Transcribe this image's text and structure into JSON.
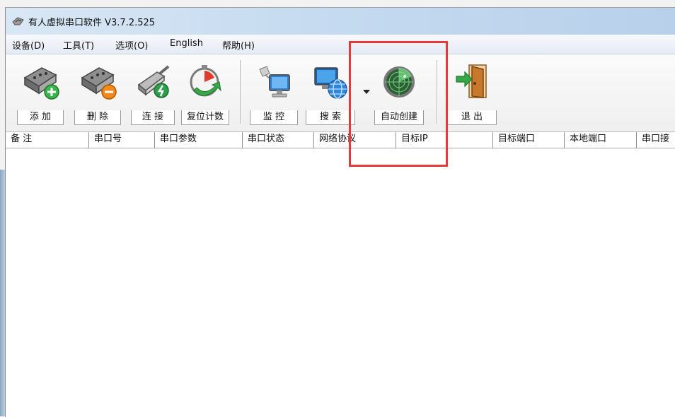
{
  "window": {
    "title": "有人虚拟串口软件 V3.7.2.525"
  },
  "menu": [
    "设备(D)",
    "工具(T)",
    "选项(O)",
    "English",
    "帮助(H)"
  ],
  "toolbar": {
    "add": "添 加",
    "delete": "删 除",
    "connect": "连 接",
    "reset_count": "复位计数",
    "monitor": "监 控",
    "search": "搜 索",
    "auto_create": "自动创建",
    "exit": "退 出"
  },
  "columns": [
    "备 注",
    "串口号",
    "串口参数",
    "串口状态",
    "网络协议",
    "目标IP",
    "目标端口",
    "本地端口",
    "串口接"
  ],
  "icons": {
    "add": "serial-port-add-icon",
    "delete": "serial-port-delete-icon",
    "connect": "network-plug-icon",
    "reset_count": "timer-reset-icon",
    "monitor": "computer-monitor-icon",
    "search": "network-globe-icon",
    "auto_create": "radar-icon",
    "exit": "door-exit-icon"
  },
  "colors": {
    "highlight": "#e23b3b",
    "titlebar": "#c6dbf0"
  }
}
